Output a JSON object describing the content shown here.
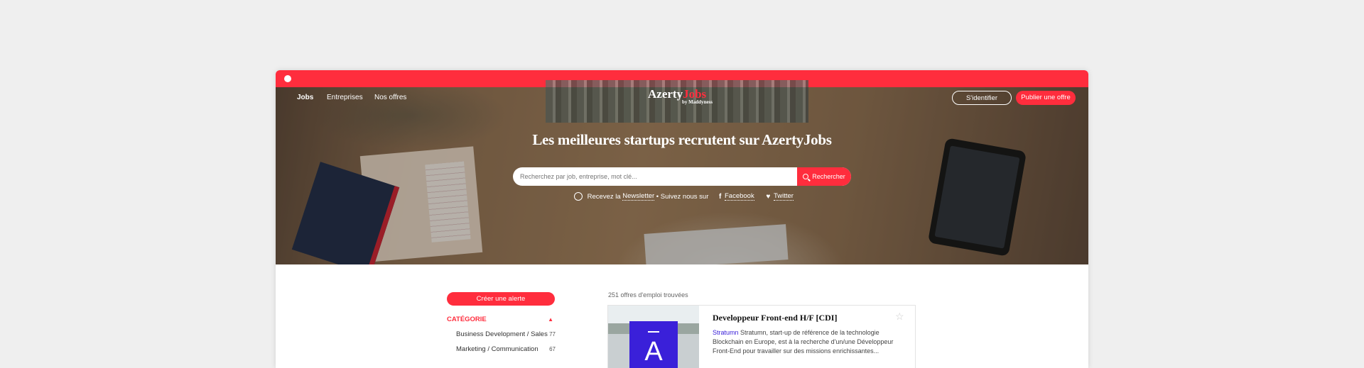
{
  "nav": {
    "items": [
      {
        "label": "Jobs",
        "active": true
      },
      {
        "label": "Entreprises"
      },
      {
        "label": "Nos offres"
      }
    ],
    "logo": {
      "main": "Azerty",
      "accent": "Jobs",
      "by": "by Maddyness"
    },
    "login_label": "S'identifier",
    "publish_label": "Publier une offre"
  },
  "hero": {
    "title": "Les meilleures startups recrutent sur AzertyJobs",
    "search": {
      "placeholder": "Recherchez par job, entreprise, mot clé...",
      "button_label": "Rechercher",
      "button_icon": "search-icon"
    },
    "social": {
      "newsletter_prefix": "Recevez la",
      "newsletter_link": "Newsletter",
      "separator": "•",
      "follow_text": "Suivez nous sur",
      "facebook": "Facebook",
      "twitter": "Twitter"
    }
  },
  "sidebar": {
    "alert_button": "Créer une alerte",
    "category_title": "CATÉGORIE",
    "categories": [
      {
        "label": "Business Development / Sales",
        "count": "77"
      },
      {
        "label": "Marketing / Communication",
        "count": "67"
      }
    ]
  },
  "results": {
    "count_text": "251 offres d'emploi trouvées",
    "jobs": [
      {
        "title": "Developpeur Front-end H/F [CDI]",
        "company": "Stratumn",
        "description": " Stratumn, start-up de référence de la technologie Blockchain en Europe, est à la recherche d'un/une Développeur Front-End pour travailler sur des missions enrichissantes...",
        "logo_letter": "A"
      }
    ]
  },
  "colors": {
    "accent": "#ff2d3d",
    "company_link": "#3a20d9"
  }
}
